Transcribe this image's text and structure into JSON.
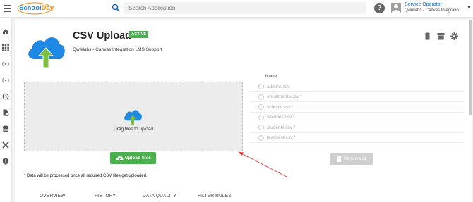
{
  "brand": {
    "part1": "School",
    "part2": "Day",
    "color_blue": "#1e88e5",
    "color_orange": "#f28a14"
  },
  "search": {
    "placeholder": "Search Application",
    "icon": "search-icon"
  },
  "help": {
    "icon": "help-circle-icon",
    "glyph": "?"
  },
  "user": {
    "name": "Service Operator",
    "org": "Qwiklabs - Canvas Integration LMS Support",
    "icon": "avatar-icon"
  },
  "nav_icons": [
    "home-icon",
    "apps-grid-icon",
    "broadcast-icon",
    "broadcast-alt-icon",
    "history-icon",
    "document-settings-icon",
    "database-icon",
    "tools-icon",
    "shield-icon"
  ],
  "app": {
    "title": "CSV Upload",
    "status": "ACTIVE",
    "status_color": "#4caf50",
    "subtitle": "Qwiklabs - Canvas Integration LMS Support",
    "actions": [
      "delete-icon",
      "archive-icon",
      "settings-gear-icon"
    ]
  },
  "dropzone": {
    "text": "Drag files to upload"
  },
  "upload_button": {
    "label": "Upload files"
  },
  "note": "* Data will be processed once all required CSV files get uploaded.",
  "files": {
    "header": "Name",
    "items": [
      "admins.csv",
      "enrollments.csv *",
      "schools.csv *",
      "sections.csv *",
      "students.csv *",
      "teachers.csv *"
    ]
  },
  "remove_button": {
    "label": "Remove all"
  },
  "tabs": [
    "OVERVIEW",
    "HISTORY",
    "DATA QUALITY",
    "FILTER RULES"
  ],
  "annotation": {
    "color": "#e53935"
  }
}
